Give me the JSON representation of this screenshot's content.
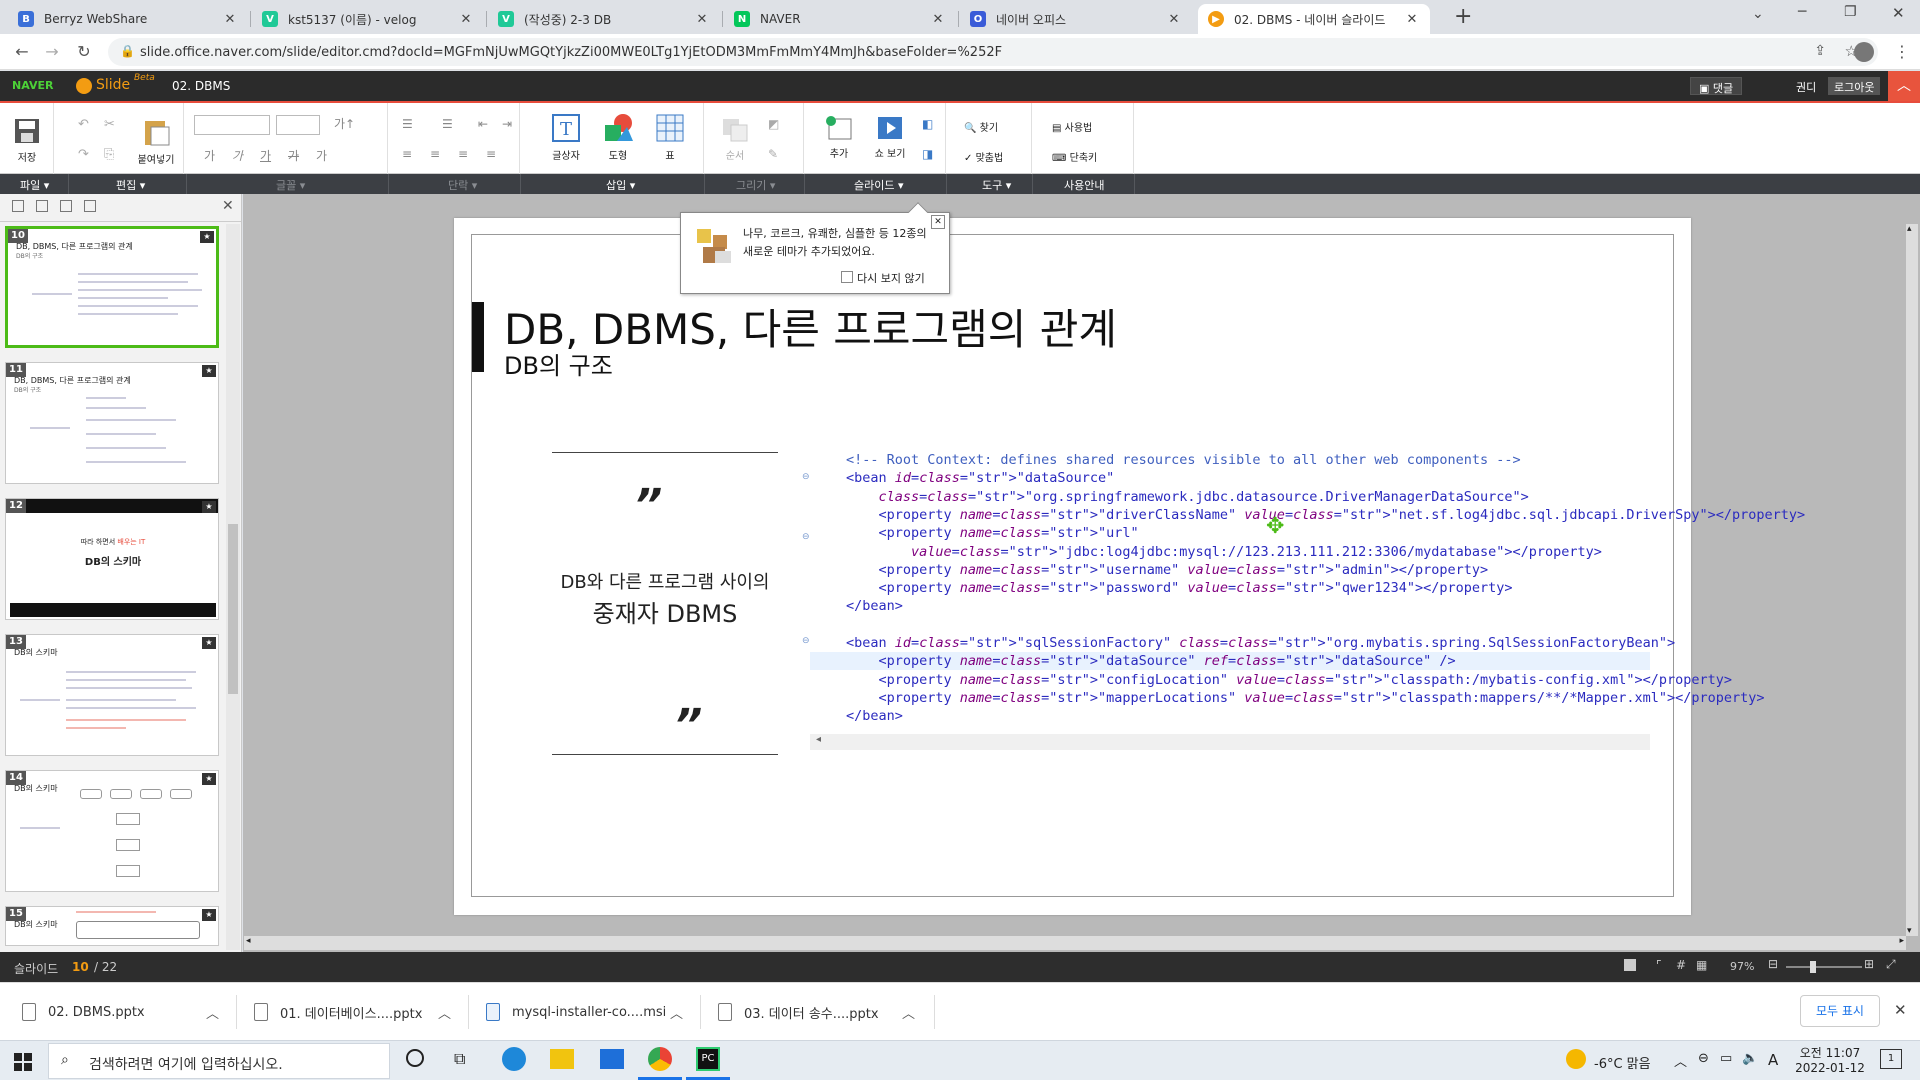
{
  "browser": {
    "tabs": [
      {
        "title": "Berryz WebShare",
        "icon_color": "#3a6fd8",
        "icon": "B"
      },
      {
        "title": "kst5137 (이름) - velog",
        "icon_color": "#20c997",
        "icon": "V"
      },
      {
        "title": "(작성중) 2-3 DB",
        "icon_color": "#20c997",
        "icon": "V"
      },
      {
        "title": "NAVER",
        "icon_color": "#03c75a",
        "icon": "N"
      },
      {
        "title": "네이버 오피스",
        "icon_color": "#3a5bd8",
        "icon": "O"
      },
      {
        "title": "02. DBMS - 네이버 슬라이드",
        "icon_color": "#f39c12",
        "icon": "▶"
      }
    ],
    "url": "slide.office.naver.com/slide/editor.cmd?docId=MGFmNjUwMGQtYjkzZi00MWE0LTg1YjEtODM3MmFmMmY4MmJh&baseFolder=%252F"
  },
  "app": {
    "brand": "NAVER",
    "product": "Slide",
    "beta": "Beta",
    "doc_title": "02. DBMS",
    "comment_button": "댓글",
    "user": "권디",
    "logout": "로그아웃"
  },
  "ribbon": {
    "save": "저장",
    "paste": "붙여넣기",
    "textbox": "글상자",
    "shape": "도형",
    "table": "표",
    "order": "순서",
    "add": "추가",
    "show": "쇼 보기",
    "find": "찾기",
    "spell": "맞춤법",
    "dictionary": "사용법",
    "shortcut": "단축키",
    "font_style_labels": [
      "가",
      "가",
      "가",
      "가",
      "가"
    ]
  },
  "menu": {
    "file": "파일",
    "edit": "편집",
    "font": "글꼴",
    "paragraph": "단락",
    "insert": "삽입",
    "draw": "그리기",
    "slide": "슬라이드",
    "tools": "도구",
    "help": "사용안내"
  },
  "thumbnails": [
    {
      "num": "10",
      "title": "DB, DBMS, 다른 프로그램의 관계",
      "sub": "DB의 구조"
    },
    {
      "num": "11",
      "title": "DB, DBMS, 다른 프로그램의 관계",
      "sub": "DB의 구조"
    },
    {
      "num": "12",
      "line1_a": "따라 하면서",
      "line1_b": "배우는 IT",
      "line2": "DB의 스키마"
    },
    {
      "num": "13",
      "title": "DB의 스키마",
      "sub": ""
    },
    {
      "num": "14",
      "title": "DB의 스키마",
      "sub": ""
    },
    {
      "num": "15",
      "title": "DB의 스키마",
      "sub": ""
    }
  ],
  "tooltip": {
    "text": "나무, 코르크, 유쾌한, 심플한 등 12종의 새로운 테마가 추가되었어요.",
    "checkbox": "다시 보지 않기"
  },
  "slide": {
    "title": "DB, DBMS, 다른 프로그램의 관계",
    "subtitle": "DB의 구조",
    "quote_open": "”",
    "quote_close": "”",
    "quote_line1": "DB와 다른 프로그램 사이의",
    "quote_line2": "중재자 DBMS",
    "code": [
      "<!-- Root Context: defines shared resources visible to all other web components -->",
      "<bean id=\"dataSource\"",
      "    class=\"org.springframework.jdbc.datasource.DriverManagerDataSource\">",
      "    <property name=\"driverClassName\" value=\"net.sf.log4jdbc.sql.jdbcapi.DriverSpy\"></property>",
      "    <property name=\"url\"",
      "        value=\"jdbc:log4jdbc:mysql://123.213.111.212:3306/mydatabase\"></property>",
      "    <property name=\"username\" value=\"admin\"></property>",
      "    <property name=\"password\" value=\"qwer1234\"></property>",
      "</bean>",
      "",
      "<bean id=\"sqlSessionFactory\" class=\"org.mybatis.spring.SqlSessionFactoryBean\">",
      "    <property name=\"dataSource\" ref=\"dataSource\" />",
      "    <property name=\"configLocation\" value=\"classpath:/mybatis-config.xml\"></property>",
      "    <property name=\"mapperLocations\" value=\"classpath:mappers/**/*Mapper.xml\"></property>",
      "</bean>"
    ]
  },
  "status": {
    "slide_label": "슬라이드",
    "current": "10",
    "total": "/ 22",
    "zoom": "97%"
  },
  "downloads": {
    "items": [
      "02. DBMS.pptx",
      "01. 데이터베이스....pptx",
      "mysql-installer-co....msi",
      "03. 데이터 송수....pptx"
    ],
    "show_all": "모두 표시"
  },
  "taskbar": {
    "search_placeholder": "검색하려면 여기에 입력하십시오.",
    "weather": "-6°C 맑음",
    "ime": "A",
    "time": "오전 11:07",
    "date": "2022-01-12",
    "notification_count": "1"
  }
}
